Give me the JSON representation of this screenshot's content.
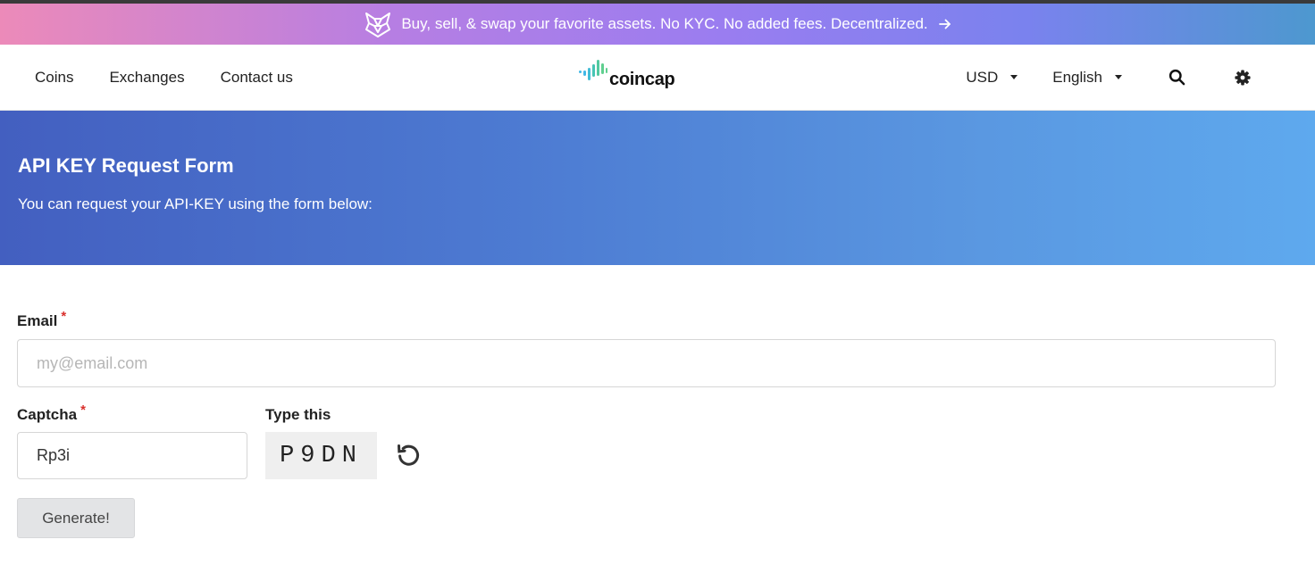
{
  "promo": {
    "text": "Buy, sell, & swap your favorite assets. No KYC. No added fees. Decentralized.",
    "icon": "fox-icon",
    "arrow_icon": "arrow-right-icon"
  },
  "nav": {
    "links": [
      {
        "label": "Coins"
      },
      {
        "label": "Exchanges"
      },
      {
        "label": "Contact us"
      }
    ],
    "logo_text": "coincap",
    "currency": "USD",
    "language": "English",
    "icons": [
      "search-icon",
      "gear-icon"
    ]
  },
  "hero": {
    "title": "API KEY Request Form",
    "subtitle": "You can request your API-KEY using the form below:"
  },
  "form": {
    "email_label": "Email",
    "required_mark": "*",
    "email_placeholder": "my@email.com",
    "captcha_label": "Captcha",
    "captcha_value": "Rp3i",
    "type_this_label": "Type this",
    "captcha_code": "P9DN",
    "refresh_icon": "refresh-icon",
    "submit_label": "Generate!"
  },
  "colors": {
    "promo_gradient": [
      "#ec8ab9",
      "#9a7df0",
      "#4d98cf"
    ],
    "hero_gradient": [
      "#435fc0",
      "#5ea9ee"
    ],
    "required": "#d9302c",
    "logo_bars": [
      "#3fb7e6",
      "#46c4b4",
      "#5fcf8f"
    ]
  }
}
